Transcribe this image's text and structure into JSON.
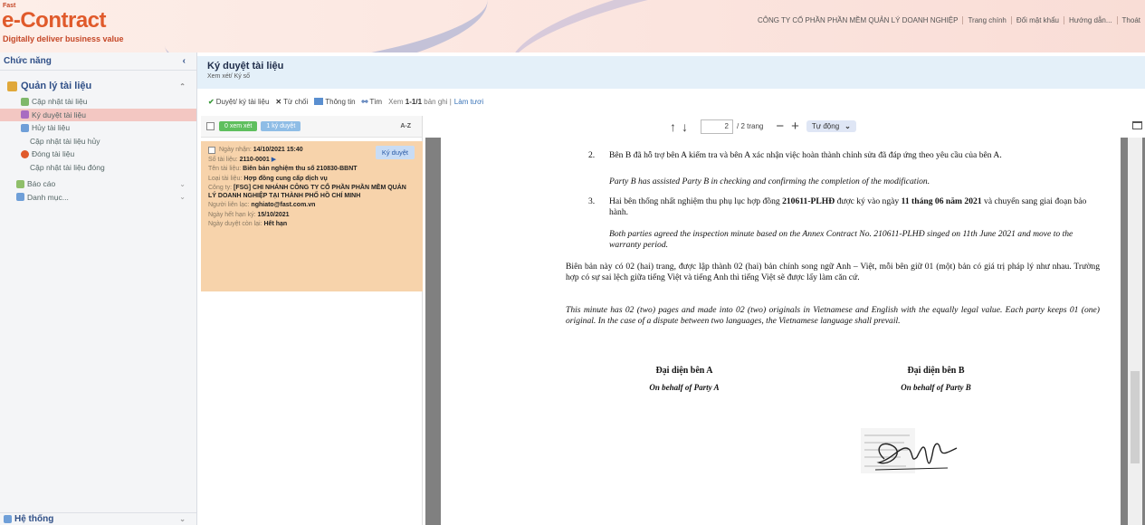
{
  "header": {
    "logo_small": "Fast",
    "logo": "e-Contract",
    "tagline": "Digitally deliver business value",
    "nav": [
      "CÔNG TY CỔ PHẦN PHẦN MỀM QUẢN LÝ DOANH NGHIỆP",
      "Trang chính",
      "Đổi mật khẩu",
      "Hướng dẫn...",
      "Thoát"
    ]
  },
  "sidebar": {
    "title": "Chức năng",
    "collapse": "‹",
    "group": "Quản lý tài liệu",
    "items": [
      {
        "label": "Cập nhật tài liệu",
        "color": "#7fb86b"
      },
      {
        "label": "Ký duyệt tài liệu",
        "color": "#a86cc1"
      },
      {
        "label": "Hủy tài liệu",
        "color": "#6f9fd8"
      },
      {
        "label": "Cập nhật tài liệu hủy",
        "color": ""
      },
      {
        "label": "Đóng tài liệu",
        "color": "#e05a2b"
      },
      {
        "label": "Cập nhật tài liệu đóng",
        "color": ""
      }
    ],
    "second": [
      {
        "label": "Báo cáo",
        "color": "#8fbf6a"
      },
      {
        "label": "Danh mục...",
        "color": "#6f9fd8"
      }
    ],
    "bottom": "Hệ thống"
  },
  "page": {
    "title": "Ký duyệt tài liệu",
    "breadcrumb": "Xem xét/ Ký số"
  },
  "toolbar": {
    "approve": "Duyệt/ ký tài liệu",
    "reject": "Từ chối",
    "info": "Thông tin",
    "find": "Tìm",
    "view_prefix": "Xem",
    "range": "1-1/1",
    "view_suffix": "bản ghi |",
    "refresh": "Làm tươi"
  },
  "list": {
    "filter_reviewed": "0 xem xét",
    "filter_signed": "1 ký duyệt",
    "sort": "A-Z",
    "card": {
      "received_label": "Ngày nhận:",
      "received": "14/10/2021 15:40",
      "sign_button": "Ký duyệt",
      "number_label": "Số tài liệu:",
      "number": "2110-0001",
      "name_label": "Tên tài liệu:",
      "name": "Biên bản nghiệm thu số 210830-BBNT",
      "type_label": "Loại tài liệu:",
      "type": "Hợp đồng cung cấp dịch vụ",
      "company_label": "Công ty:",
      "company": "[FSG] CHI NHÁNH CÔNG TY CỔ PHẦN PHẦN MỀM QUẢN LÝ DOANH NGHIỆP TẠI THÀNH PHỐ HỒ CHÍ MINH",
      "contact_label": "Người liên lạc:",
      "contact": "nghiato@fast.com.vn",
      "due_label": "Ngày hết hạn ký:",
      "due": "15/10/2021",
      "remaining_label": "Ngày duyệt còn lại:",
      "remaining": "Hết hạn"
    }
  },
  "viewer": {
    "page": "2",
    "total": "/ 2 trang",
    "zoom": "Tự động"
  },
  "document": {
    "item2_num": "2.",
    "item2_vi": "Bên B đã hỗ trợ bên A kiểm tra và bên A xác nhận việc hoàn thành chỉnh sửa đã đáp ứng theo yêu cầu của bên A.",
    "item2_en": "Party B has assisted Party B in checking and confirming the completion of the modification.",
    "item3_num": "3.",
    "item3_vi_a": "Hai bên thống nhất nghiệm thu phụ lục hợp đồng ",
    "item3_vi_code": "210611-PLHĐ",
    "item3_vi_b": " được ký vào ngày ",
    "item3_vi_date": "11 tháng 06 năm 2021",
    "item3_vi_c": " và chuyển sang giai đoạn bảo hành.",
    "item3_en": "Both parties agreed the inspection minute based on the Annex Contract No. 210611-PLHĐ singed on 11th June 2021 and move to the warranty period.",
    "para_vi": "Biên bản này có 02 (hai) trang, được lập thành 02 (hai) bản chính song ngữ Anh – Việt, mỗi bên giữ 01 (một) bản có giá trị pháp lý như nhau. Trường hợp có sự sai lệch giữa tiếng Việt và tiếng Anh thì tiếng Việt sẽ được lấy làm căn cứ.",
    "para_en": "This minute has 02 (two) pages and made into 02 (two) originals in Vietnamese and English with the equally legal value. Each party keeps 01 (one) original. In the case of a dispute between two languages, the Vietnamese language shall prevail.",
    "party_a": "Đại diện bên A",
    "party_a_en": "On behalf of Party A",
    "party_b": "Đại diện bên B",
    "party_b_en": "On behalf of Party B"
  }
}
